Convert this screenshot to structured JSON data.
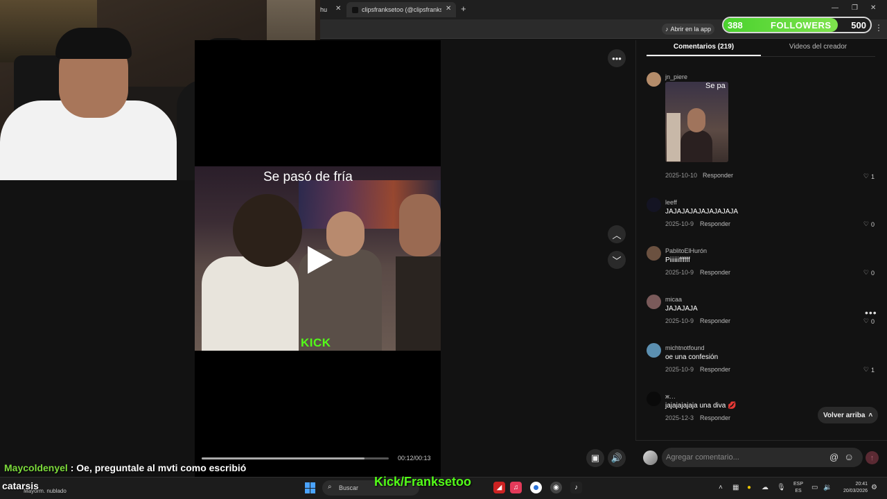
{
  "browser": {
    "tab_prev": "hu",
    "tab_active": "clipsfranksetoo (@clipsfranks…",
    "tab_close": "✕",
    "newtab": "+",
    "open_app": "Abrir en la app"
  },
  "followers_widget": {
    "current": "388",
    "label": "FOLLOWERS",
    "goal": "500",
    "progress_fraction": 0.776
  },
  "search": {
    "placeholder": ""
  },
  "video": {
    "caption": "Se pasó de fría",
    "watermark": "KICK",
    "time": "00:12/00:13",
    "progress_fraction": 0.87
  },
  "comments": {
    "tab_comments": "Comentarios (219)",
    "tab_creator": "Videos del creador",
    "reply_label": "Responder",
    "items": [
      {
        "user": "jn_piere",
        "text": "",
        "media_text": "Se pa",
        "date": "2025-10-10",
        "likes": "1",
        "avatar_color": "#b48c6a"
      },
      {
        "user": "leeff",
        "text": "JAJAJAJAJAJAJAJAJA",
        "date": "2025-10-9",
        "likes": "0",
        "avatar_color": "#141423"
      },
      {
        "user": "PablitoElHurón",
        "text": "Piiiiiiffffff",
        "date": "2025-10-9",
        "likes": "0",
        "avatar_color": "#6b5140"
      },
      {
        "user": "micaa",
        "text": "JAJAJAJA",
        "date": "2025-10-9",
        "likes": "0",
        "avatar_color": "#7a5a5a"
      },
      {
        "user": "michtnotfound",
        "text": "oe una confesión",
        "date": "2025-10-9",
        "likes": "1",
        "avatar_color": "#5b8fb0"
      },
      {
        "user": "ж…",
        "text": "jajajajajaja una diva 💋",
        "date": "2025-12-3",
        "likes": "",
        "avatar_color": "#0a0a0a"
      }
    ],
    "scroll_top": "Volver arriba",
    "input_placeholder": "Agregar comentario..."
  },
  "overlay": {
    "chat_user": "Maycoldenyel",
    "chat_message": ": Oe, preguntale al mvti como escribió",
    "brand": "catarsis",
    "kick_channel": "Kick/Franksetoo"
  },
  "taskbar": {
    "weather": "Mayorm. nublado",
    "search_label": "Buscar",
    "lang_top": "ESP",
    "lang_bottom": "ES",
    "time": "20:41",
    "date": "20/03/2026"
  },
  "colors": {
    "kick_green": "#53fc18",
    "followers_green": "#4ad22e",
    "chat_user_green": "#7ddc3c"
  }
}
